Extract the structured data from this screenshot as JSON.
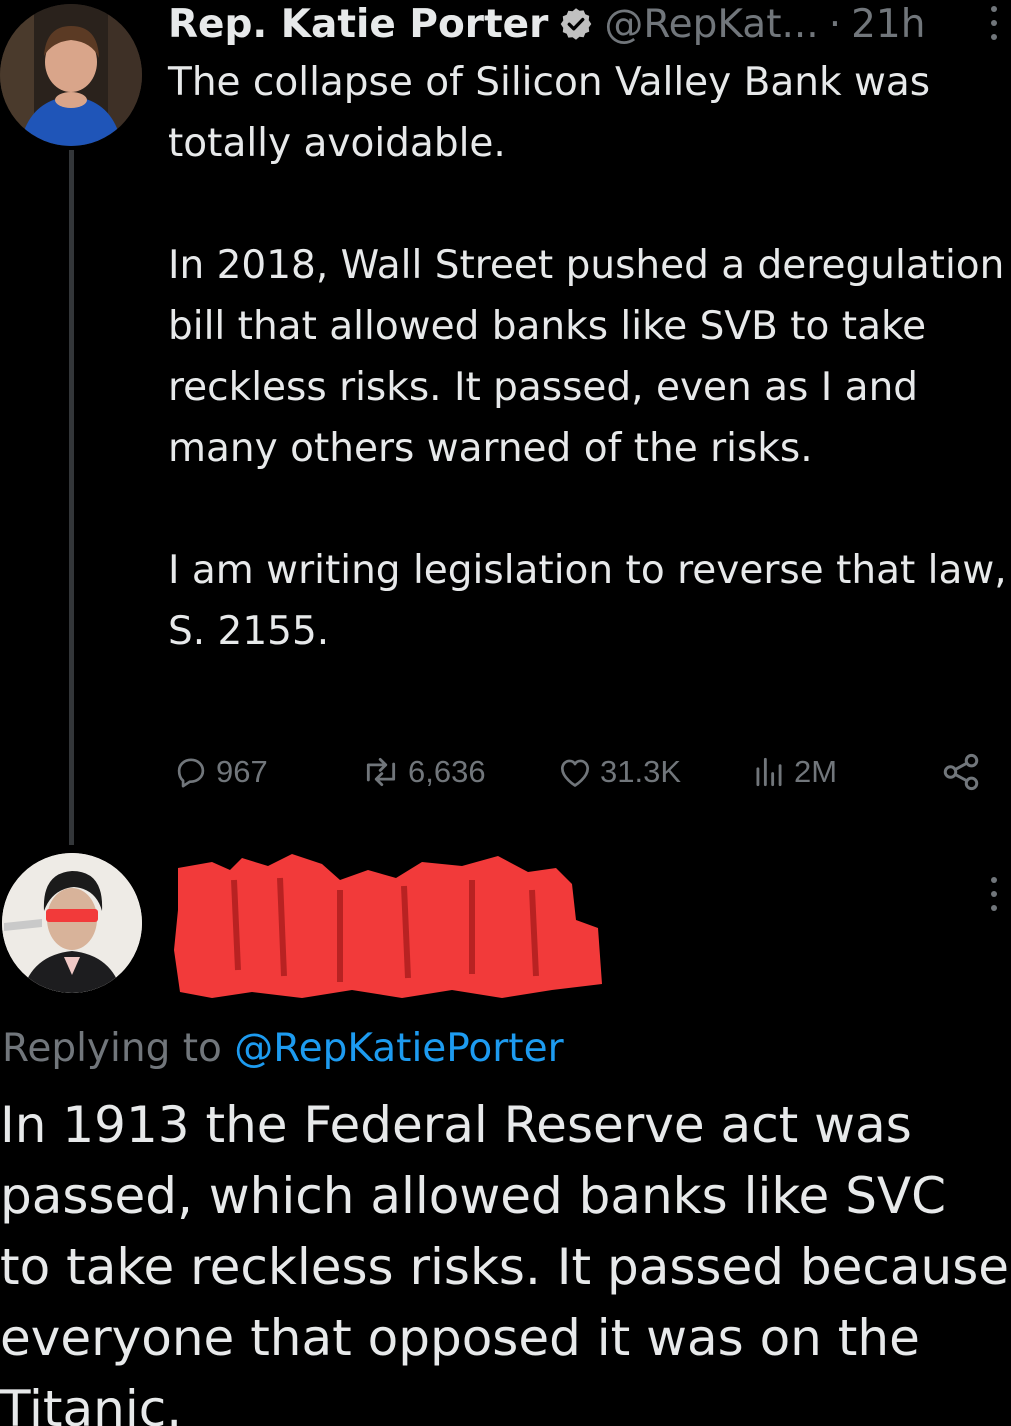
{
  "colors": {
    "background": "#000000",
    "text_primary": "#e7e9ea",
    "text_secondary": "#71767b",
    "link": "#1d9bf0",
    "verified_badge": "#c0c0c0",
    "redaction": "#f23a3a"
  },
  "tweet": {
    "author_name": "Rep. Katie Porter",
    "verified_icon": "verified-badge-icon",
    "handle": "@RepKat...",
    "separator": "·",
    "time": "21h",
    "paragraphs": [
      "The collapse of Silicon Valley Bank was totally avoidable.",
      "In 2018, Wall Street pushed a deregulation bill that allowed banks like SVB to take reckless risks. It passed, even as I and many others warned of the risks.",
      "I am writing legislation to reverse that law, S. 2155."
    ],
    "actions": {
      "replies": "967",
      "retweets": "6,636",
      "likes": "31.3K",
      "views": "2M"
    }
  },
  "reply": {
    "replying_prefix": "Replying to",
    "replying_to": "@RepKatiePorter",
    "text": "In 1913 the Federal Reserve act was passed, which allowed banks like SVC to take reckless risks. It passed because everyone that opposed it was on the Titanic."
  }
}
